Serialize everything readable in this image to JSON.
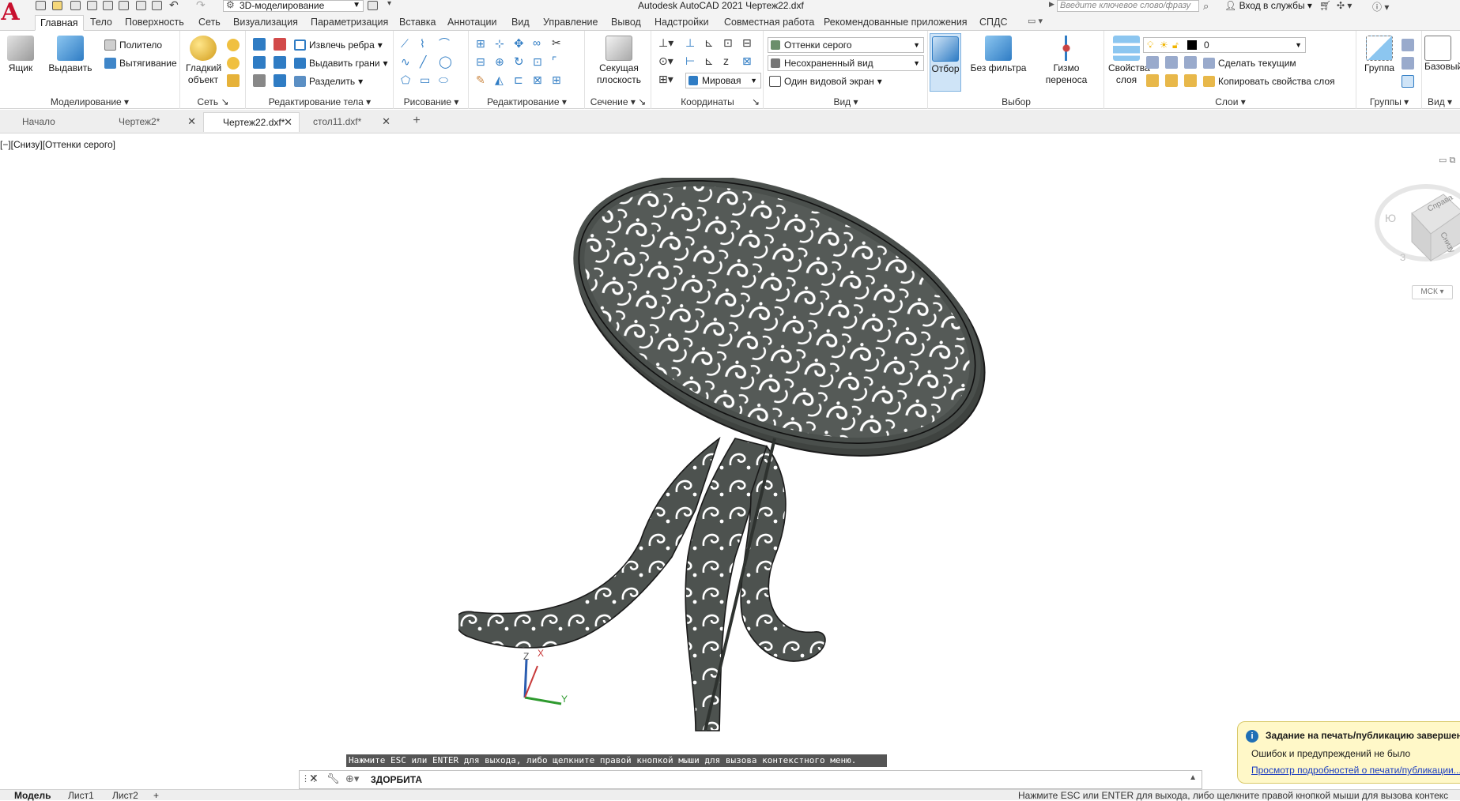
{
  "titlebar": {
    "workspace": "3D-моделирование",
    "title": "Autodesk AutoCAD 2021    Чертеж22.dxf",
    "search_placeholder": "Введите ключевое слово/фразу",
    "login": "Вход в службы"
  },
  "ribbon_tabs": [
    "Главная",
    "Тело",
    "Поверхность",
    "Сеть",
    "Визуализация",
    "Параметризация",
    "Вставка",
    "Аннотации",
    "Вид",
    "Управление",
    "Вывод",
    "Надстройки",
    "Совместная работа",
    "Рекомендованные приложения",
    "СПДС"
  ],
  "ribbon": {
    "modeling": {
      "title": "Моделирование",
      "box": "Ящик",
      "extrude": "Выдавить",
      "polysolid": "Полителo",
      "presspull": "Вытягивание"
    },
    "mesh": {
      "title": "Сеть",
      "smooth_object": "Гладкий объект"
    },
    "solid_editing": {
      "title": "Редактирование тела",
      "extract_edges": "Извлечь ребра",
      "extrude_faces": "Выдавить грани",
      "separate": "Разделить"
    },
    "draw": {
      "title": "Рисование"
    },
    "modify": {
      "title": "Редактирование"
    },
    "section": {
      "title": "Сечение",
      "section_plane": "Секущая плоскость"
    },
    "coordinates": {
      "title": "Координаты",
      "ucs_world": "Мировая"
    },
    "view": {
      "title": "Вид",
      "visual_style": "Оттенки серого",
      "named_view": "Несохраненный вид",
      "viewport": "Один видовой экран"
    },
    "selection": {
      "title": "Выбор",
      "culling": "Отбор",
      "no_filter": "Без фильтра",
      "gizmo": "Гизмо переноса"
    },
    "layers": {
      "title": "Слои",
      "layer_properties": "Свойства слоя",
      "current_layer": "0",
      "make_current": "Сделать текущим",
      "match_layer": "Копировать свойства слоя"
    },
    "groups": {
      "title": "Группы",
      "group": "Группа"
    },
    "view2": {
      "title": "Вид",
      "base": "Базовый"
    }
  },
  "doc_tabs": [
    {
      "label": "Начало",
      "active": false,
      "closable": false
    },
    {
      "label": "Чертеж2*",
      "active": false,
      "closable": true
    },
    {
      "label": "Чертеж22.dxf*",
      "active": true,
      "closable": true
    },
    {
      "label": "стол11.dxf*",
      "active": false,
      "closable": true
    }
  ],
  "viewport": {
    "label": "[−][Снизу][Оттенки серого]",
    "viewcube_faces": [
      "Справа",
      "Снизу"
    ],
    "ucs_name": "МСК"
  },
  "command": {
    "prompt": "Нажмите ESC или ENTER для выхода, либо щелкните правой кнопкой мыши для вызова контекстного меню.",
    "current": "3ДОРБИТА"
  },
  "statusbar": {
    "tabs": [
      "Модель",
      "Лист1",
      "Лист2"
    ],
    "message": "Нажмите ESC или ENTER для выхода, либо щелкните правой кнопкой мыши для вызова контекс"
  },
  "notification": {
    "title": "Задание на печать/публикацию завершено",
    "body": "Ошибок и предупреждений не было",
    "link": "Просмотр подробностей о печати/публикации..."
  },
  "colors": {
    "accent": "#1f6fb5",
    "logo": "#c8102e",
    "model_fill": "#505552",
    "notification_bg": "#fff8c8"
  }
}
